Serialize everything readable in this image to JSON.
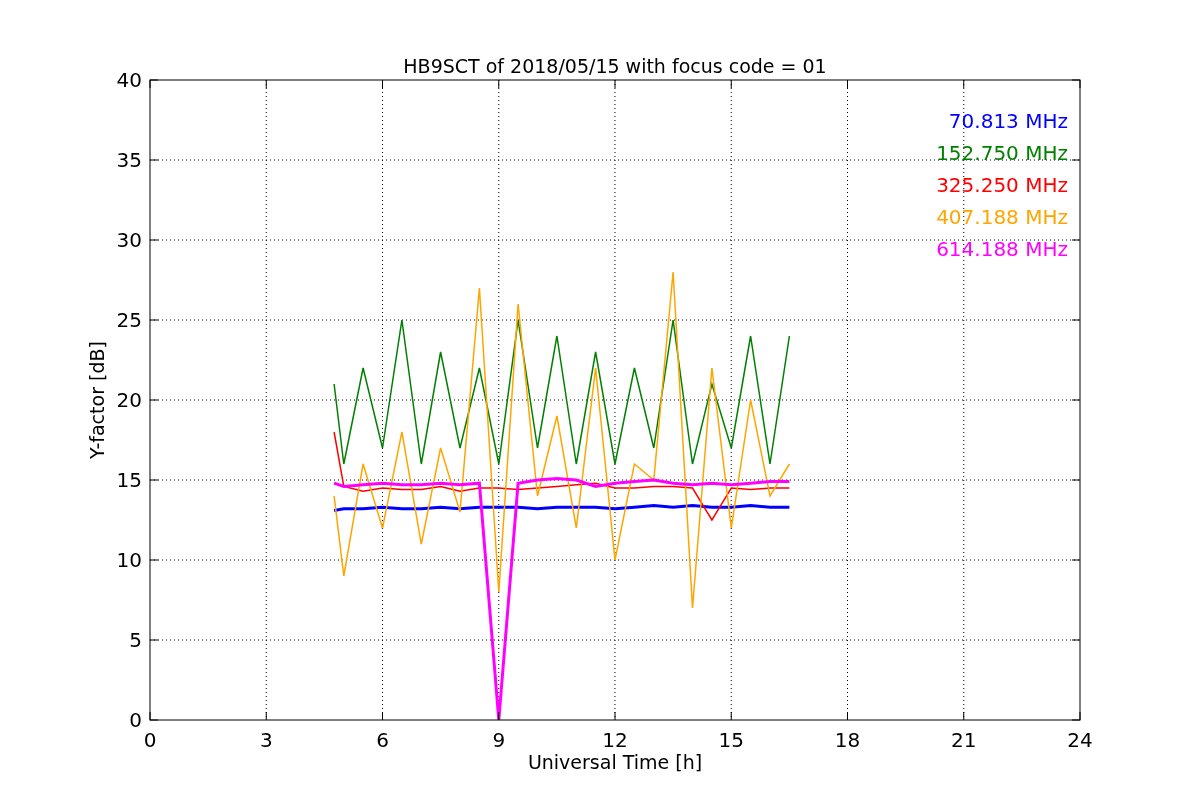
{
  "chart_data": {
    "type": "line",
    "grid": true,
    "title": "HB9SCT of 2018/05/15 with focus code = 01",
    "xlabel": "Universal Time [h]",
    "ylabel": "Y-factor [dB]",
    "xlim": [
      0,
      24
    ],
    "ylim": [
      0,
      40
    ],
    "xticks": [
      0,
      3,
      6,
      9,
      12,
      15,
      18,
      21,
      24
    ],
    "yticks": [
      0,
      5,
      10,
      15,
      20,
      25,
      30,
      35,
      40
    ],
    "x": [
      4.75,
      5,
      5.5,
      6,
      6.5,
      7,
      7.5,
      8,
      8.5,
      9,
      9.5,
      10,
      10.5,
      11,
      11.5,
      12,
      12.5,
      13,
      13.5,
      14,
      14.5,
      15,
      15.5,
      16,
      16.5
    ],
    "series": [
      {
        "name": "70.813 MHz",
        "color": "#0000ff",
        "values": [
          13.1,
          13.2,
          13.2,
          13.3,
          13.2,
          13.2,
          13.3,
          13.2,
          13.3,
          13.3,
          13.3,
          13.2,
          13.3,
          13.3,
          13.3,
          13.2,
          13.3,
          13.4,
          13.3,
          13.4,
          13.3,
          13.3,
          13.4,
          13.3,
          13.3
        ]
      },
      {
        "name": "152.750 MHz",
        "color": "#008000",
        "values": [
          21,
          16,
          22,
          17,
          25,
          16,
          23,
          17,
          22,
          16,
          25,
          17,
          24,
          16,
          23,
          16,
          22,
          17,
          25,
          16,
          21,
          17,
          24,
          16,
          24
        ]
      },
      {
        "name": "325.250 MHz",
        "color": "#ff0000",
        "values": [
          18,
          14.6,
          14.3,
          14.5,
          14.4,
          14.4,
          14.6,
          14.3,
          14.5,
          14.5,
          14.4,
          14.5,
          14.6,
          14.7,
          14.8,
          14.5,
          14.5,
          14.6,
          14.6,
          14.5,
          12.5,
          14.5,
          14.4,
          14.5,
          14.5
        ]
      },
      {
        "name": "407.188 MHz",
        "color": "#ffa500",
        "values": [
          14,
          9,
          16,
          12,
          18,
          11,
          17,
          13,
          27,
          8,
          26,
          14,
          19,
          12,
          22,
          10,
          16,
          15,
          28,
          7,
          22,
          12,
          20,
          14,
          16
        ]
      },
      {
        "name": "614.188 MHz",
        "color": "#ff00ff",
        "values": [
          14.8,
          14.6,
          14.7,
          14.8,
          14.7,
          14.7,
          14.8,
          14.7,
          14.8,
          0,
          14.8,
          15.0,
          15.1,
          15.0,
          14.6,
          14.8,
          14.9,
          15.0,
          14.8,
          14.7,
          14.8,
          14.7,
          14.8,
          14.9,
          14.9
        ]
      }
    ]
  }
}
